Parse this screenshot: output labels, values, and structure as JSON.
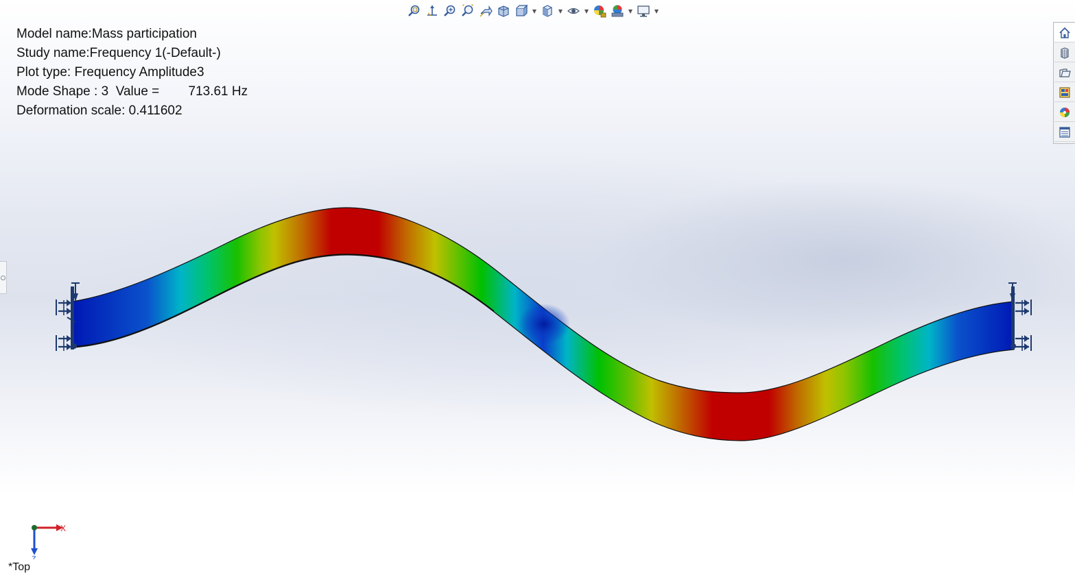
{
  "plot_info": {
    "model_name": "Model name:Mass participation",
    "study_name": "Study name:Frequency 1(-Default-)",
    "plot_type": "Plot type: Frequency Amplitude3",
    "mode_shape": "Mode Shape : 3  Value =        713.61 Hz",
    "deformation_scale": "Deformation scale: 0.411602"
  },
  "triad": {
    "x_label": "X",
    "z_label": "Z"
  },
  "view_orientation": "*Top",
  "toolbar_icons": [
    "zoom-to-fit-icon",
    "zoom-to-area-icon",
    "zoom-in-out-icon",
    "zoom-selection-icon",
    "previous-view-icon",
    "section-view-icon",
    "dynamic-annotation-icon",
    "view-orientation-icon",
    "display-style-icon",
    "hide-show-icon",
    "edit-appearance-icon",
    "apply-scene-icon",
    "view-settings-icon"
  ],
  "taskpane_icons": [
    "home-icon",
    "design-library-icon",
    "file-explorer-icon",
    "view-palette-icon",
    "appearances-icon",
    "custom-properties-icon"
  ],
  "colors": {
    "contour_max": "#c00000",
    "contour_high": "#c0c000",
    "contour_mid": "#00c000",
    "contour_low": "#00b4c8",
    "contour_min": "#0018b4",
    "fixture": "#1e3a6e",
    "triad_x": "#d0202a",
    "triad_z": "#1f4fd0"
  }
}
